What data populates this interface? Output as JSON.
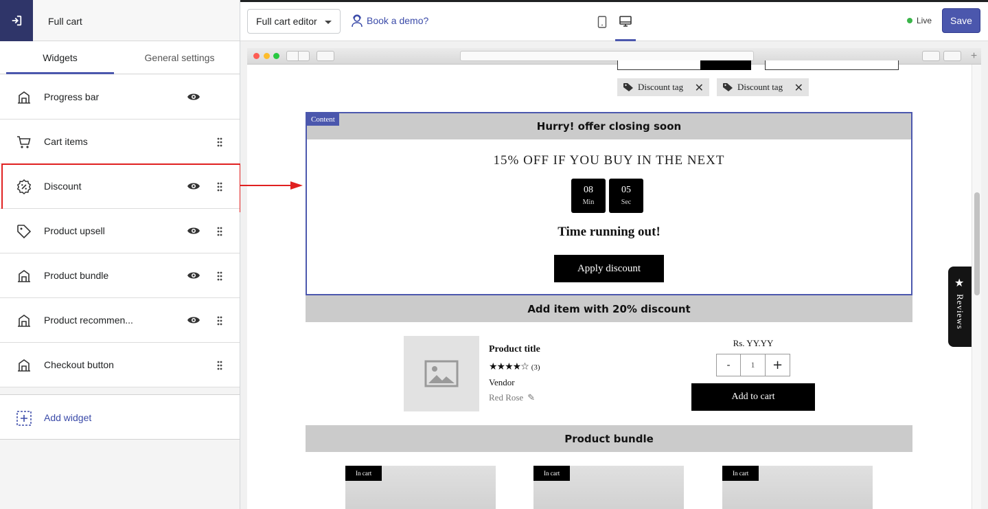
{
  "sidebar": {
    "title": "Full cart",
    "tabs": [
      {
        "label": "Widgets",
        "active": true
      },
      {
        "label": "General settings",
        "active": false
      }
    ],
    "items": [
      {
        "label": "Progress bar",
        "icon": "layout-block-icon",
        "visible_toggle": true,
        "drag": false
      },
      {
        "label": "Cart items",
        "icon": "cart-icon",
        "visible_toggle": false,
        "drag": true
      },
      {
        "label": "Discount",
        "icon": "discount-icon",
        "visible_toggle": true,
        "drag": true
      },
      {
        "label": "Product upsell",
        "icon": "tag-icon",
        "visible_toggle": true,
        "drag": true
      },
      {
        "label": "Product bundle",
        "icon": "layout-block-icon",
        "visible_toggle": true,
        "drag": true
      },
      {
        "label": "Product recommen...",
        "icon": "layout-block-icon",
        "visible_toggle": true,
        "drag": true
      },
      {
        "label": "Checkout button",
        "icon": "layout-block-icon",
        "visible_toggle": false,
        "drag": true
      }
    ],
    "add_widget_label": "Add widget"
  },
  "topbar": {
    "editor_select": "Full cart editor",
    "demo_link": "Book a demo?",
    "status": "Live",
    "save_label": "Save"
  },
  "preview": {
    "discount_tags": [
      "Discount tag",
      "Discount tag"
    ],
    "content_label": "Content",
    "discount_header": "Hurry! offer closing soon",
    "discount_title": "15% OFF IF YOU BUY IN THE NEXT",
    "timer": {
      "minutes": "08",
      "min_label": "Min",
      "seconds": "05",
      "sec_label": "Sec"
    },
    "running_text": "Time running out!",
    "apply_label": "Apply discount",
    "upsell_header": "Add item with 20% discount",
    "product": {
      "title": "Product title",
      "stars": "★★★★☆",
      "rating_count": "(3)",
      "vendor": "Vendor",
      "variant": "Red Rose",
      "price": "Rs. YY.YY",
      "qty_minus": "-",
      "qty": "1",
      "qty_plus": "+",
      "add_to_cart": "Add to cart"
    },
    "bundle_header": "Product bundle",
    "bundle_badges": [
      "In cart",
      "In cart",
      "In cart"
    ],
    "reviews_label": "Reviews"
  },
  "colors": {
    "accent": "#4b57ad",
    "highlight": "#e02020",
    "live": "#3bb54a"
  }
}
